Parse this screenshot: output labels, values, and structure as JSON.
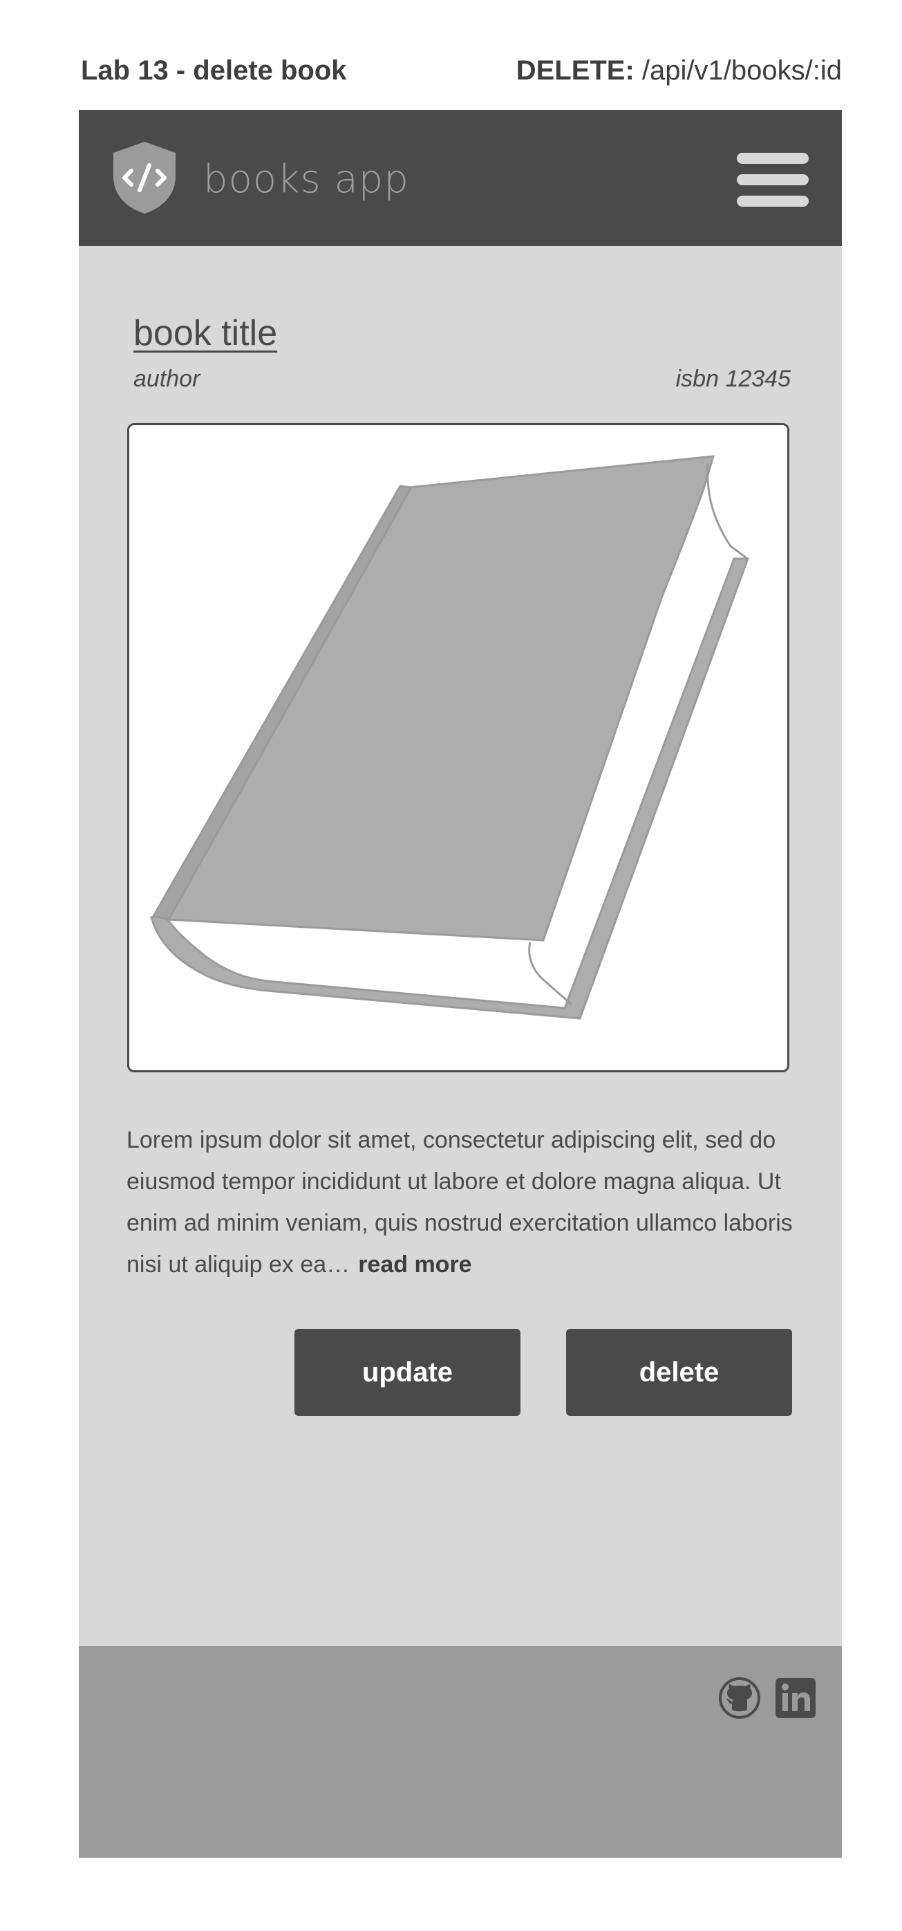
{
  "caption": {
    "title": "Lab 13 - delete book",
    "method": "DELETE:",
    "path": " /api/v1/books/:id"
  },
  "header": {
    "app_name": "books app",
    "logo_icon": "shield-code-icon",
    "menu_icon": "hamburger-menu-icon"
  },
  "book": {
    "title": "book title",
    "author": "author",
    "isbn": "isbn 12345",
    "cover_icon": "book-icon",
    "description": "Lorem ipsum dolor sit amet, consectetur adipiscing elit, sed do eiusmod tempor incididunt ut labore et dolore magna aliqua. Ut enim ad minim veniam, quis nostrud exercitation ullamco laboris nisi ut aliquip ex ea…",
    "read_more": "read more"
  },
  "actions": {
    "update_label": "update",
    "delete_label": "delete"
  },
  "footer": {
    "icons": [
      "github-icon",
      "linkedin-icon"
    ]
  },
  "colors": {
    "dark": "#4a4a4a",
    "panel": "#d8d8d8",
    "footer": "#9b9b9b",
    "cover": "#adadad"
  }
}
